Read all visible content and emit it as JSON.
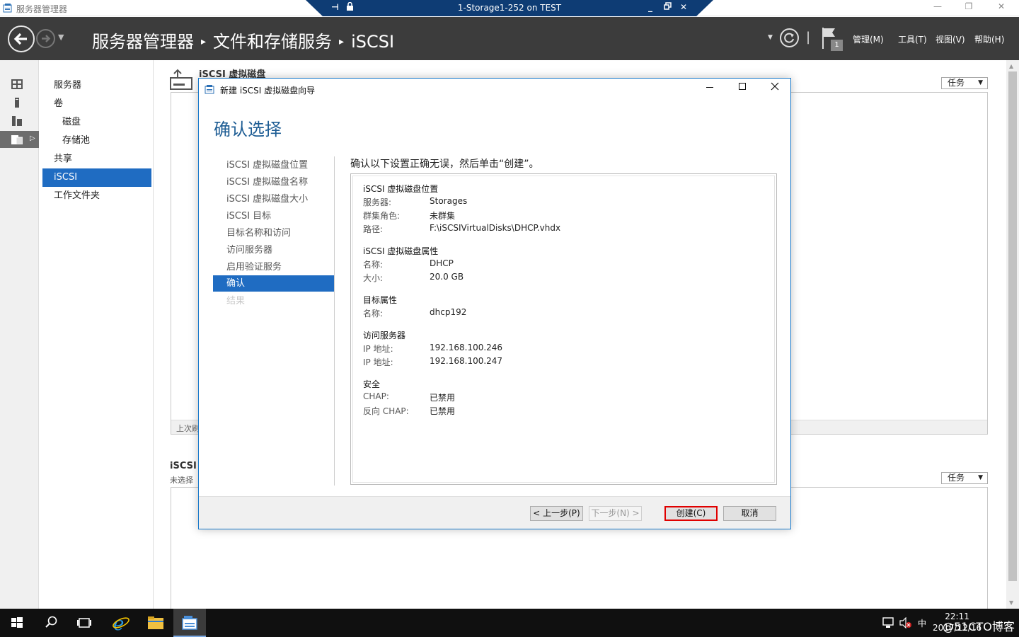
{
  "window": {
    "title": "服务器管理器",
    "minimize": "—",
    "restore": "❐",
    "close": "✕"
  },
  "remote_bar": {
    "title": "1-Storage1-252 on TEST",
    "pin": "⊣",
    "lock": "🔒",
    "min": "_",
    "restore": "🗗",
    "close": "✕"
  },
  "header": {
    "breadcrumb": [
      "服务器管理器",
      "文件和存储服务",
      "iSCSI"
    ],
    "separator": "▸",
    "flag_badge": "1",
    "menus": [
      "管理(M)",
      "工具(T)",
      "视图(V)",
      "帮助(H)"
    ],
    "pipe": "|"
  },
  "subnav": {
    "items": [
      {
        "label": "服务器",
        "child": false,
        "active": false
      },
      {
        "label": "卷",
        "child": false,
        "active": false
      },
      {
        "label": "磁盘",
        "child": true,
        "active": false
      },
      {
        "label": "存储池",
        "child": true,
        "active": false
      },
      {
        "label": "共享",
        "child": false,
        "active": false
      },
      {
        "label": "iSCSI",
        "child": false,
        "active": true
      },
      {
        "label": "工作文件夹",
        "child": false,
        "active": false
      }
    ]
  },
  "content": {
    "section1_title": "iSCSI 虚拟磁盘",
    "tasks_label": "任务",
    "panel1_footer": "上次刷",
    "section2_title": "iSCSI",
    "section2_sub": "未选择"
  },
  "dialog": {
    "title": "新建 iSCSI 虚拟磁盘向导",
    "heading": "确认选择",
    "steps": [
      {
        "label": "iSCSI 虚拟磁盘位置",
        "state": "normal"
      },
      {
        "label": "iSCSI 虚拟磁盘名称",
        "state": "normal"
      },
      {
        "label": "iSCSI 虚拟磁盘大小",
        "state": "normal"
      },
      {
        "label": "iSCSI 目标",
        "state": "normal"
      },
      {
        "label": "目标名称和访问",
        "state": "normal"
      },
      {
        "label": "访问服务器",
        "state": "normal"
      },
      {
        "label": "启用验证服务",
        "state": "normal"
      },
      {
        "label": "确认",
        "state": "active"
      },
      {
        "label": "结果",
        "state": "disabled"
      }
    ],
    "instruction": "确认以下设置正确无误，然后单击“创建”。",
    "summary": [
      {
        "heading": "iSCSI 虚拟磁盘位置",
        "rows": [
          {
            "label": "服务器:",
            "value": "Storages"
          },
          {
            "label": "群集角色:",
            "value": "未群集"
          },
          {
            "label": "路径:",
            "value": "F:\\iSCSIVirtualDisks\\DHCP.vhdx"
          }
        ]
      },
      {
        "heading": "iSCSI 虚拟磁盘属性",
        "rows": [
          {
            "label": "名称:",
            "value": "DHCP"
          },
          {
            "label": "大小:",
            "value": "20.0 GB"
          }
        ]
      },
      {
        "heading": "目标属性",
        "rows": [
          {
            "label": "名称:",
            "value": "dhcp192"
          }
        ]
      },
      {
        "heading": "访问服务器",
        "rows": [
          {
            "label": "IP 地址:",
            "value": "192.168.100.246"
          },
          {
            "label": "IP 地址:",
            "value": "192.168.100.247"
          }
        ]
      },
      {
        "heading": "安全",
        "rows": [
          {
            "label": "CHAP:",
            "value": "已禁用"
          },
          {
            "label": "反向 CHAP:",
            "value": "已禁用"
          }
        ]
      }
    ],
    "buttons": {
      "prev": "< 上一步(P)",
      "next": "下一步(N) >",
      "create": "创建(C)",
      "cancel": "取消"
    }
  },
  "taskbar": {
    "ime": "中",
    "time": "22:11",
    "date": "2017/12/16",
    "watermark": "@51CTO博客"
  },
  "colors": {
    "accent": "#1f6cc2",
    "header_bg": "#3c3c3c",
    "heading_blue": "#1e5d94",
    "highlight_red": "#e00000"
  }
}
